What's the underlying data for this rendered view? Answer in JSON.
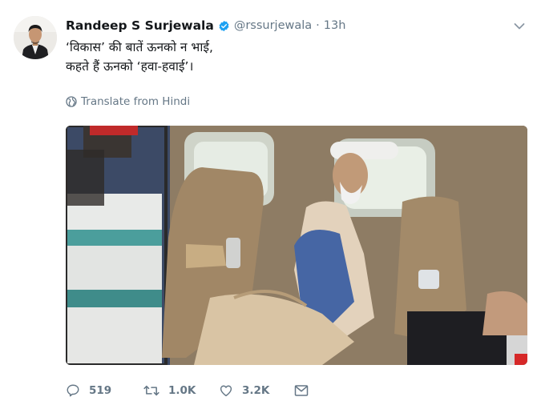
{
  "tweet": {
    "author_name": "Randeep S Surjewala",
    "handle": "@rssurjewala",
    "separator": "·",
    "time": "13h",
    "text_line1": "‘विकास’ की बातें ऊनको न भाई,",
    "text_line2": "कहते हैं ऊनको ‘हवा-हवाई’।",
    "translate_label": "Translate from Hindi"
  },
  "actions": {
    "replies": "519",
    "retweets": "1.0K",
    "likes": "3.2K"
  },
  "colors": {
    "text": "#14171a",
    "secondary": "#657786",
    "verified": "#1da1f2"
  }
}
